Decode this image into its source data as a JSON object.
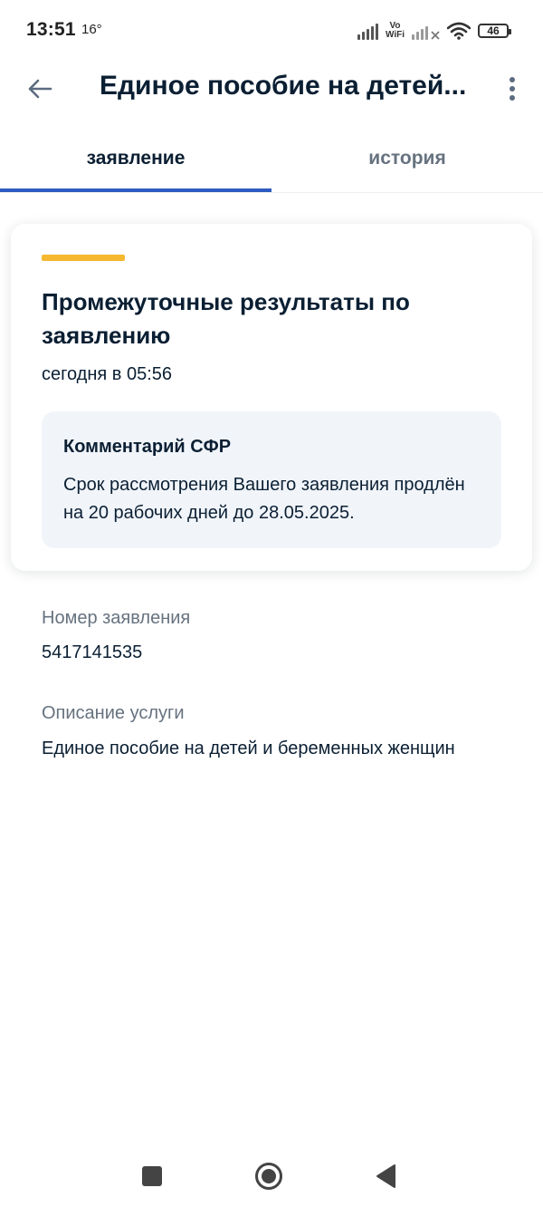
{
  "status_bar": {
    "time": "13:51",
    "temperature": "16°",
    "vowifi_top": "Vo",
    "vowifi_bottom": "WiFi",
    "battery": "46"
  },
  "app_bar": {
    "title": "Единое пособие на детей..."
  },
  "tabs": [
    {
      "label": "заявление",
      "active": true
    },
    {
      "label": "история",
      "active": false
    }
  ],
  "card": {
    "title": "Промежуточные результаты по заявлению",
    "time": "сегодня в 05:56",
    "comment": {
      "title": "Комментарий СФР",
      "text": "Срок рассмотрения Вашего заявления продлён на 20 рабочих дней до 28.05.2025."
    }
  },
  "fields": {
    "application_number": {
      "label": "Номер заявления",
      "value": "5417141535"
    },
    "service_description": {
      "label": "Описание услуги",
      "value": "Единое пособие на детей и беременных женщин"
    }
  },
  "colors": {
    "accent_bar": "#f5b82e",
    "active_tab_underline": "#2d5bbf",
    "primary_text": "#0b1f33",
    "secondary_text": "#66727f",
    "comment_bg": "#f1f5fa"
  },
  "icons": {
    "back": "arrow-left-icon",
    "menu": "more-vertical-icon",
    "nav_recents": "square-icon",
    "nav_home": "circle-icon",
    "nav_back": "triangle-back-icon"
  }
}
